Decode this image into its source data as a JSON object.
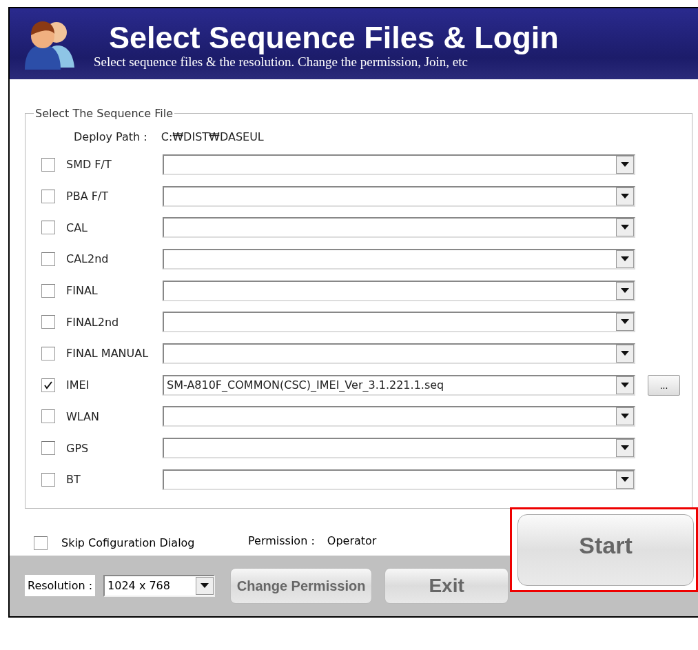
{
  "header": {
    "title": "Select Sequence Files & Login",
    "subtitle": "Select sequence files & the resolution. Change the permission, Join, etc"
  },
  "sequence_group": {
    "title": "Select The Sequence File",
    "deploy_path_label": "Deploy Path :",
    "deploy_path": "C:₩DIST₩DASEUL",
    "rows": [
      {
        "label": "SMD F/T",
        "checked": false,
        "value": ""
      },
      {
        "label": "PBA F/T",
        "checked": false,
        "value": ""
      },
      {
        "label": "CAL",
        "checked": false,
        "value": ""
      },
      {
        "label": "CAL2nd",
        "checked": false,
        "value": ""
      },
      {
        "label": "FINAL",
        "checked": false,
        "value": ""
      },
      {
        "label": "FINAL2nd",
        "checked": false,
        "value": ""
      },
      {
        "label": "FINAL MANUAL",
        "checked": false,
        "value": ""
      },
      {
        "label": "IMEI",
        "checked": true,
        "value": "SM-A810F_COMMON(CSC)_IMEI_Ver_3.1.221.1.seq",
        "browse": "..."
      },
      {
        "label": "WLAN",
        "checked": false,
        "value": ""
      },
      {
        "label": "GPS",
        "checked": false,
        "value": ""
      },
      {
        "label": "BT",
        "checked": false,
        "value": ""
      }
    ]
  },
  "skip_dialog": {
    "label": "Skip Cofiguration Dialog",
    "checked": false
  },
  "permission": {
    "label": "Permission :",
    "value": "Operator"
  },
  "resolution": {
    "label": "Resolution :",
    "value": "1024 x 768"
  },
  "buttons": {
    "change_permission": "Change Permission",
    "exit": "Exit",
    "start": "Start"
  }
}
